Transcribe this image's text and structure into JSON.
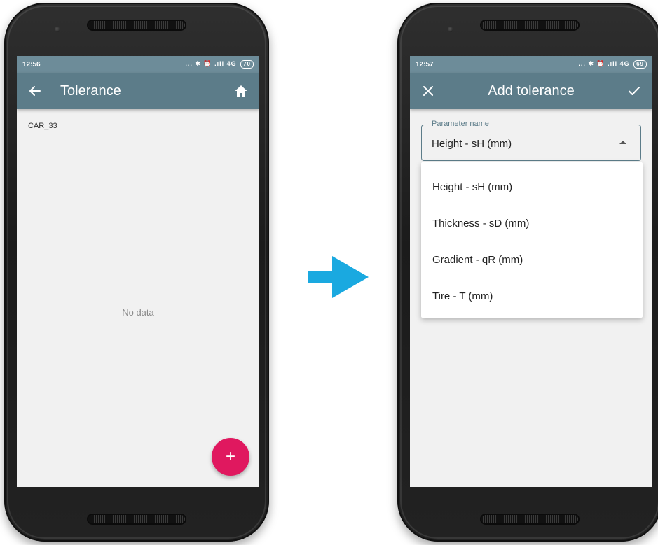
{
  "left_phone": {
    "status_time": "12:56",
    "status_icons": "... ✱ ⏰ .ıll 4G",
    "battery": "70",
    "app_title": "Tolerance",
    "record_label": "CAR_33",
    "empty_text": "No data",
    "fab_label": "+"
  },
  "right_phone": {
    "status_time": "12:57",
    "status_icons": "... ✱ ⏰ .ıll 4G",
    "battery": "69",
    "app_title": "Add tolerance",
    "field_label": "Parameter name",
    "field_value": "Height - sH (mm)",
    "options": [
      "Height - sH (mm)",
      "Thickness - sD (mm)",
      "Gradient - qR (mm)",
      "Tire - T (mm)"
    ]
  },
  "icons": {
    "back": "arrow-left-icon",
    "home": "home-icon",
    "close": "close-icon",
    "confirm": "check-icon",
    "transition": "arrow-right-icon"
  },
  "colors": {
    "appbar": "#5c7c89",
    "statusbar": "#6d8c99",
    "fab": "#e0185f",
    "arrow": "#1aa9e0",
    "background": "#f1f1f1"
  }
}
